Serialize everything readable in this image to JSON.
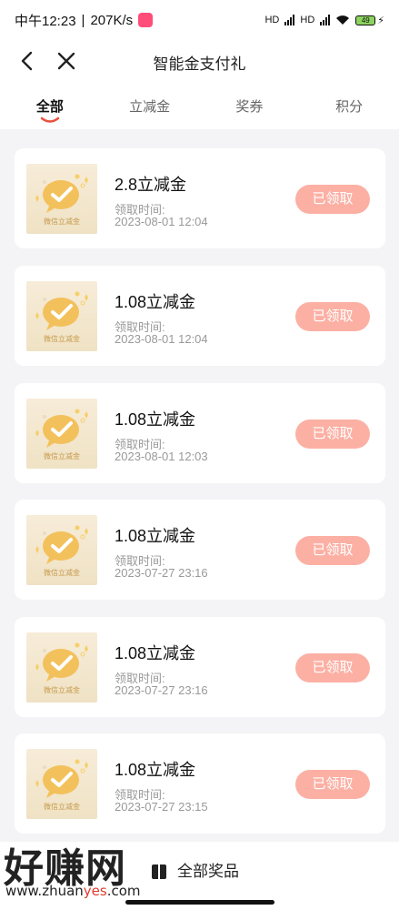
{
  "status_bar": {
    "time": "中午12:23",
    "speed": "207K/s",
    "sig1": "HD",
    "sig2": "HD",
    "battery": "49"
  },
  "nav": {
    "title": "智能金支付礼"
  },
  "tabs": [
    {
      "label": "全部",
      "active": true
    },
    {
      "label": "立减金",
      "active": false
    },
    {
      "label": "奖券",
      "active": false
    },
    {
      "label": "积分",
      "active": false
    }
  ],
  "cards": [
    {
      "amount": "2.8立减金",
      "got_label": "领取时间:",
      "time": "2023-08-01 12:04",
      "button": "已领取",
      "thumb_label": "微信立减金"
    },
    {
      "amount": "1.08立减金",
      "got_label": "领取时间:",
      "time": "2023-08-01 12:04",
      "button": "已领取",
      "thumb_label": "微信立减金"
    },
    {
      "amount": "1.08立减金",
      "got_label": "领取时间:",
      "time": "2023-08-01 12:03",
      "button": "已领取",
      "thumb_label": "微信立减金"
    },
    {
      "amount": "1.08立减金",
      "got_label": "领取时间:",
      "time": "2023-07-27 23:16",
      "button": "已领取",
      "thumb_label": "微信立减金"
    },
    {
      "amount": "1.08立减金",
      "got_label": "领取时间:",
      "time": "2023-07-27 23:16",
      "button": "已领取",
      "thumb_label": "微信立减金"
    },
    {
      "amount": "1.08立减金",
      "got_label": "领取时间:",
      "time": "2023-07-27 23:15",
      "button": "已领取",
      "thumb_label": "微信立减金"
    }
  ],
  "bottom": {
    "label": "全部奖品"
  },
  "watermark": {
    "big": "好赚网",
    "small_pre": "www.zhuan",
    "small_hl": "yes",
    "small_post": ".com"
  },
  "colors": {
    "accent": "#e8523e",
    "button": "#fcb0a4",
    "coupon_gold": "#f3c15c"
  }
}
